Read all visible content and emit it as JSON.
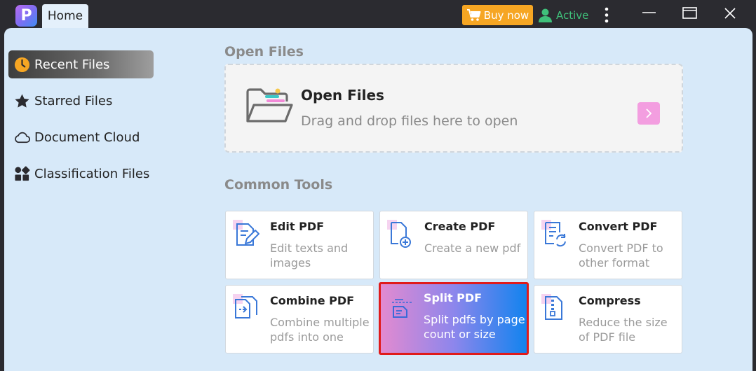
{
  "app": {
    "logo_letter": "P"
  },
  "tabs": [
    {
      "label": "Home"
    }
  ],
  "titlebar": {
    "buy_label": "Buy now",
    "status_label": "Active"
  },
  "sidebar": {
    "items": [
      {
        "label": "Recent Files",
        "icon": "clock-icon",
        "selected": true
      },
      {
        "label": "Starred Files",
        "icon": "star-icon"
      },
      {
        "label": "Document Cloud",
        "icon": "cloud-icon"
      },
      {
        "label": "Classification Files",
        "icon": "category-icon"
      }
    ]
  },
  "open_files": {
    "section_title": "Open Files",
    "title": "Open Files",
    "subtitle": "Drag and drop files here to open"
  },
  "common_tools": {
    "section_title": "Common Tools",
    "tools": [
      {
        "title": "Edit PDF",
        "desc": "Edit texts and images",
        "icon": "edit-pdf-icon"
      },
      {
        "title": "Create PDF",
        "desc": "Create a new pdf",
        "icon": "create-pdf-icon"
      },
      {
        "title": "Convert PDF",
        "desc": "Convert PDF to other format",
        "icon": "convert-pdf-icon"
      },
      {
        "title": "Combine PDF",
        "desc": "Combine multiple pdfs into one",
        "icon": "combine-pdf-icon"
      },
      {
        "title": "Split PDF",
        "desc": "Split pdfs by page count or size",
        "icon": "split-pdf-icon",
        "highlighted": true
      },
      {
        "title": "Compress",
        "desc": "Reduce the size of PDF file",
        "icon": "compress-icon"
      }
    ]
  },
  "colors": {
    "accent_orange": "#f6a623",
    "status_green": "#3fc07a",
    "content_bg": "#d7e9f9",
    "highlight_border": "#e01b1b",
    "pink": "#f39ee0",
    "blue": "#1283ee"
  }
}
